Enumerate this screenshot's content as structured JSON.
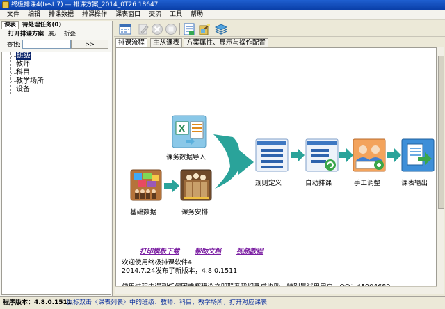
{
  "window": {
    "title": "终极排课4(test  7)  —  排课方案_2014_0T26  18647"
  },
  "menu": [
    "文件",
    "编辑",
    "排课数据",
    "排课操作",
    "课表窗口",
    "交流",
    "工具",
    "帮助"
  ],
  "left_panel": {
    "tabs": [
      "课表",
      "待处理任务(0)"
    ],
    "toolbar": {
      "open_plan": "打开排课方案",
      "expand": "展开",
      "collapse": "折叠"
    },
    "search_label": "查找:",
    "search_button": ">>",
    "tree": [
      "班级",
      "教师",
      "科目",
      "教学场所",
      "设备"
    ]
  },
  "toolbar_icons": [
    "calendar-icon",
    "edit-icon",
    "delete-icon",
    "stop-icon",
    "list-icon",
    "wand-icon",
    "layers-icon"
  ],
  "tabs": [
    "排课流程",
    "主从课表",
    "方案属性、显示与操作配置"
  ],
  "flow": {
    "import": "课务数据导入",
    "base": "基础数据",
    "arrange": "课务安排",
    "rules": "规则定义",
    "auto": "自动排课",
    "manual": "手工调整",
    "output": "课表输出"
  },
  "links": [
    "打印模板下载",
    "帮助文档",
    "视频教程"
  ],
  "info": {
    "welcome": "欢迎使用终极排课软件4",
    "release": "2014.7.24发布了新版本，4.8.0.1511",
    "support": "使用过程中遇到任何困难都建议立即联系我们寻求协助，特别是试用用户，QQ：45904680"
  },
  "status": {
    "version": "程序版本：4.8.0.1511",
    "hint": "鼠标双击〈课表列表〉中的班级、教师、科目、教学场所，打开对应课表"
  },
  "colors": {
    "arrow": "#2aa39a",
    "link": "#7b1fa2",
    "selection": "#0a246a"
  }
}
